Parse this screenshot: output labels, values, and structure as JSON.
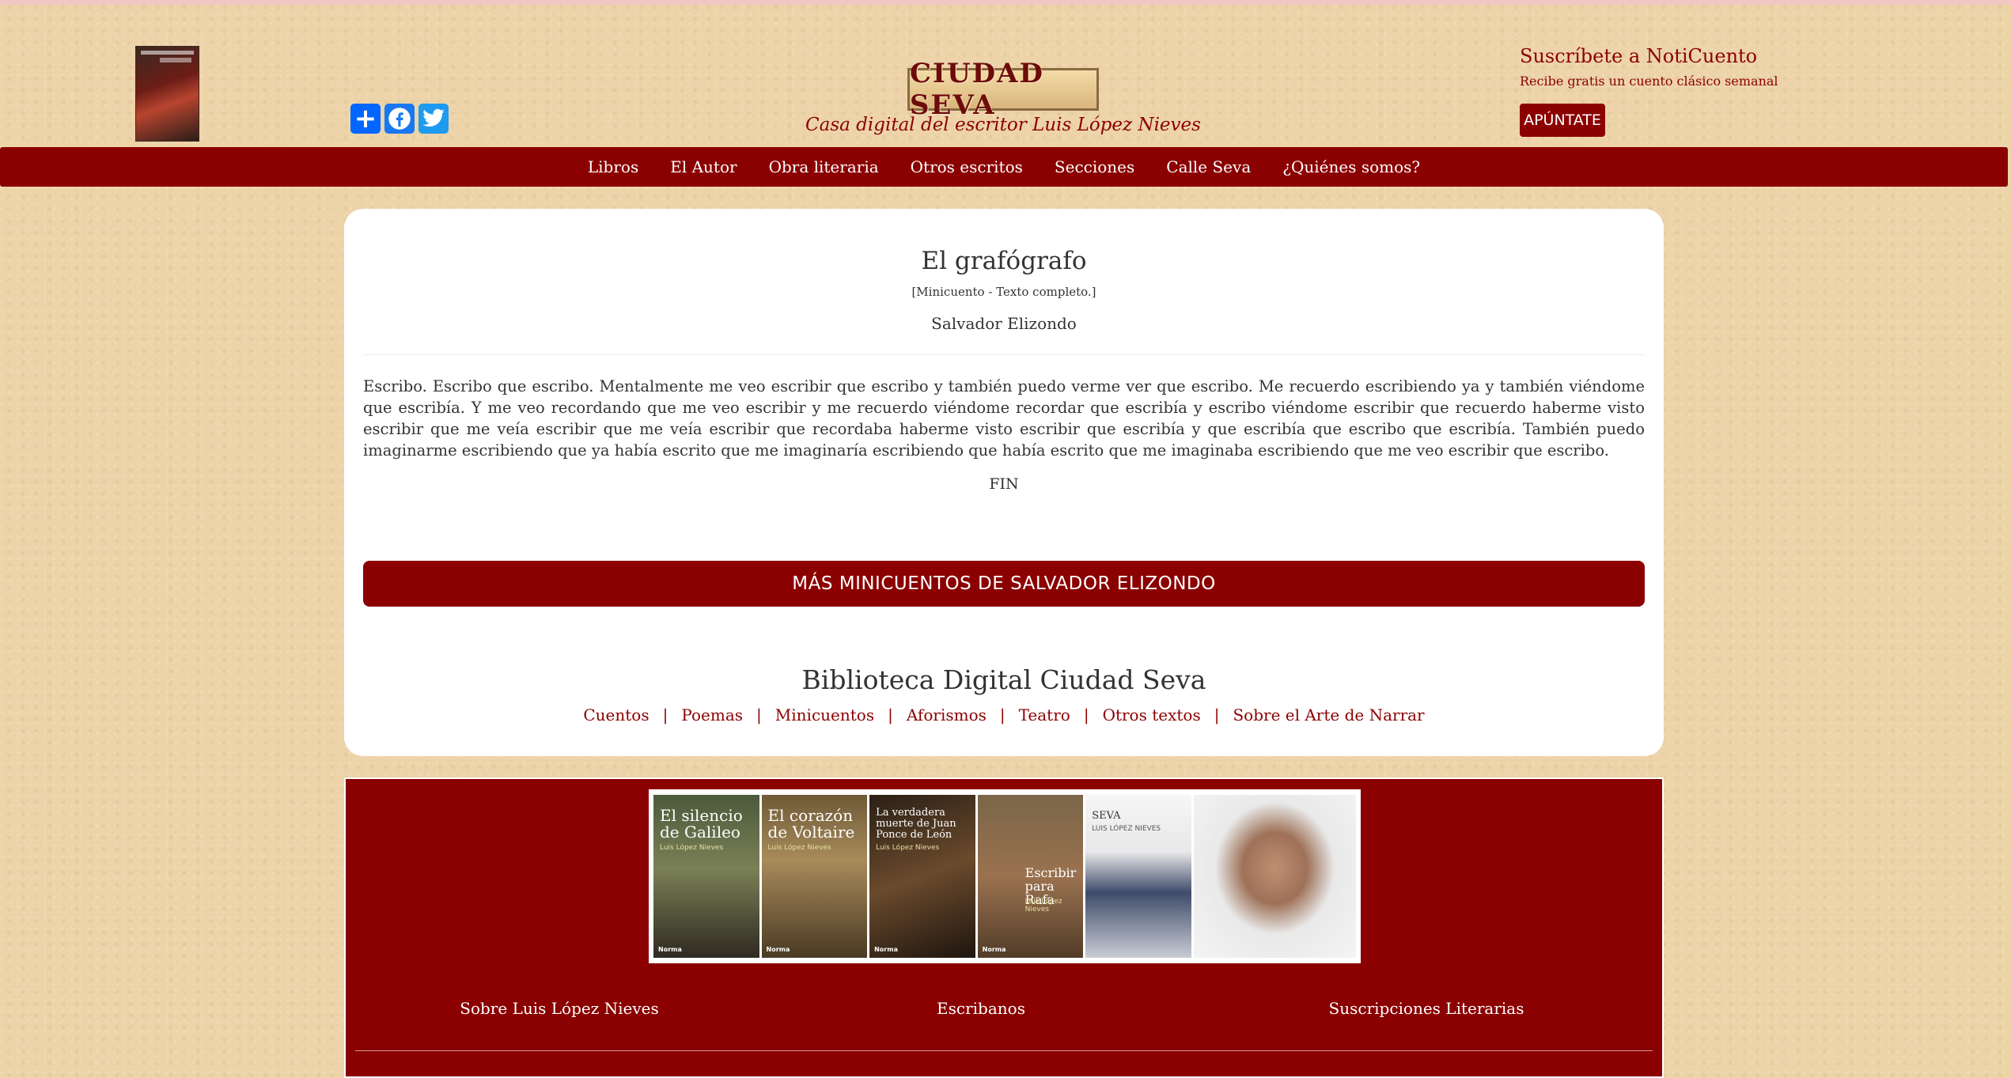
{
  "header": {
    "logo_text": "CIUDAD SEVA",
    "tagline": "Casa digital del escritor Luis López Nieves",
    "book_thumb_title": "Luis López Nieves",
    "share_buttons": [
      "share",
      "facebook",
      "twitter"
    ],
    "subscribe": {
      "title": "Suscríbete a NotiCuento",
      "subtitle": "Recibe gratis un cuento clásico semanal",
      "button_label": "APÚNTATE"
    }
  },
  "nav": {
    "items": [
      "Libros",
      "El Autor",
      "Obra literaria",
      "Otros escritos",
      "Secciones",
      "Calle Seva",
      "¿Quiénes somos?"
    ]
  },
  "story": {
    "title": "El grafógrafo",
    "meta": "[Minicuento - Texto completo.]",
    "author": "Salvador Elizondo",
    "body": "Escribo. Escribo que escribo. Mentalmente me veo escribir que escribo y también puedo verme ver que escribo. Me recuerdo escribiendo ya y también viéndome que escribía. Y me veo recordando que me veo escribir y me recuerdo viéndome recordar que escribía y escribo viéndome escribir que recuerdo haberme visto escribir que me veía escribir que me veía escribir que recordaba haberme visto escribir que escribía y que escribía que escribo que escribía. También puedo imaginarme escribiendo que ya había escrito que me imaginaría escribiendo que había escrito que me imaginaba escribiendo que me veo escribir que escribo.",
    "end": "FIN",
    "more_button": "MÁS MINICUENTOS DE SALVADOR ELIZONDO"
  },
  "library": {
    "title": "Biblioteca Digital Ciudad Seva",
    "links": [
      "Cuentos",
      "Poemas",
      "Minicuentos",
      "Aforismos",
      "Teatro",
      "Otros textos",
      "Sobre el Arte de Narrar"
    ],
    "separator": "|"
  },
  "footer": {
    "books": [
      {
        "title": "El silencio de Galileo",
        "author": "Luis López Nieves"
      },
      {
        "title": "El corazón de Voltaire",
        "author": "Luis López Nieves"
      },
      {
        "title": "La verdadera muerte de Juan Ponce de León",
        "author": "Luis López Nieves"
      },
      {
        "title": "Escribir para Rafa",
        "author": "Luis López Nieves"
      },
      {
        "title": "SEVA",
        "author": "LUIS LÓPEZ NIEVES"
      }
    ],
    "publisher": "Norma",
    "links": [
      "Sobre Luis López Nieves",
      "Escribanos",
      "Suscripciones Literarias"
    ]
  },
  "colors": {
    "brand": "#8b0000",
    "background": "#edd3a8",
    "card": "#ffffff"
  }
}
